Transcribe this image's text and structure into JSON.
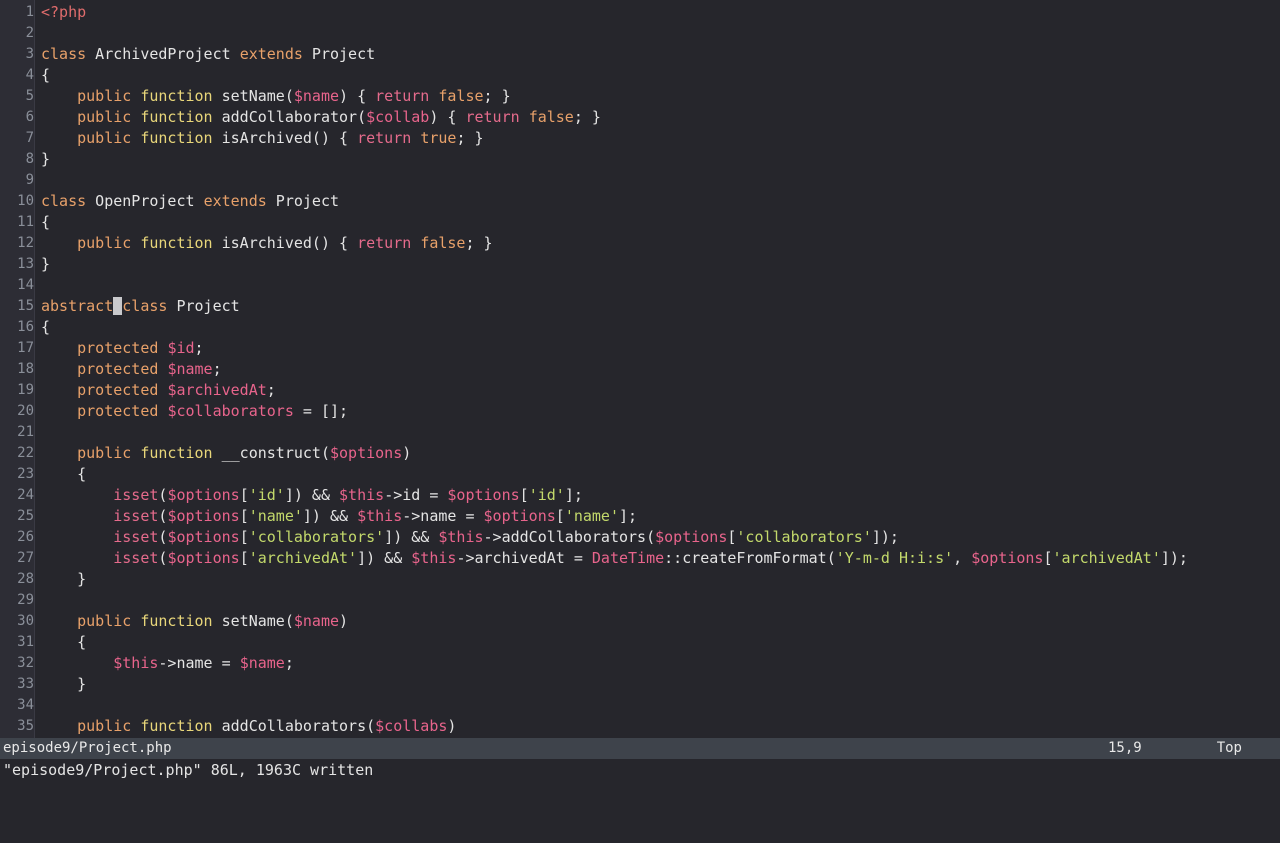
{
  "app": {
    "type": "terminal-text-editor",
    "editor": "vim",
    "language": "php"
  },
  "theme": {
    "background": "#26262c",
    "gutter_background": "#2d2d35",
    "gutter_text": "#8a8f99",
    "default_text": "#d8d8d8",
    "keyword": "#e8a16a",
    "function_keyword": "#e8d67a",
    "control": "#e56b8c",
    "variable": "#e8648c",
    "string": "#c3d96b",
    "tag": "#e06c6c",
    "class_name": "#e8648c",
    "statusline_background": "#3e434b",
    "statusline_text": "#e8e8e8",
    "cursor": "#c9c9cc"
  },
  "cursor": {
    "line": 15,
    "column": 9,
    "token_index": 1
  },
  "statusline": {
    "filename": "episode9/Project.php",
    "position": "15,9",
    "scroll": "Top"
  },
  "cmdline": {
    "message": "\"episode9/Project.php\" 86L, 1963C written"
  },
  "code": {
    "lines": [
      {
        "n": "1",
        "tokens": [
          {
            "t": "<?php",
            "c": "tok-tag"
          }
        ]
      },
      {
        "n": "2",
        "tokens": []
      },
      {
        "n": "3",
        "tokens": [
          {
            "t": "class",
            "c": "tok-kw"
          },
          {
            "t": " ArchivedProject ",
            "c": "tok-plain"
          },
          {
            "t": "extends",
            "c": "tok-kw"
          },
          {
            "t": " Project",
            "c": "tok-plain"
          }
        ]
      },
      {
        "n": "4",
        "tokens": [
          {
            "t": "{",
            "c": "tok-punc"
          }
        ]
      },
      {
        "n": "5",
        "tokens": [
          {
            "t": "    ",
            "c": "tok-plain"
          },
          {
            "t": "public",
            "c": "tok-kw"
          },
          {
            "t": " ",
            "c": "tok-plain"
          },
          {
            "t": "function",
            "c": "tok-fnkw"
          },
          {
            "t": " setName(",
            "c": "tok-plain"
          },
          {
            "t": "$name",
            "c": "tok-var"
          },
          {
            "t": ") { ",
            "c": "tok-plain"
          },
          {
            "t": "return",
            "c": "tok-ctrl"
          },
          {
            "t": " ",
            "c": "tok-plain"
          },
          {
            "t": "false",
            "c": "tok-const"
          },
          {
            "t": "; }",
            "c": "tok-plain"
          }
        ]
      },
      {
        "n": "6",
        "tokens": [
          {
            "t": "    ",
            "c": "tok-plain"
          },
          {
            "t": "public",
            "c": "tok-kw"
          },
          {
            "t": " ",
            "c": "tok-plain"
          },
          {
            "t": "function",
            "c": "tok-fnkw"
          },
          {
            "t": " addCollaborator(",
            "c": "tok-plain"
          },
          {
            "t": "$collab",
            "c": "tok-var"
          },
          {
            "t": ") { ",
            "c": "tok-plain"
          },
          {
            "t": "return",
            "c": "tok-ctrl"
          },
          {
            "t": " ",
            "c": "tok-plain"
          },
          {
            "t": "false",
            "c": "tok-const"
          },
          {
            "t": "; }",
            "c": "tok-plain"
          }
        ]
      },
      {
        "n": "7",
        "tokens": [
          {
            "t": "    ",
            "c": "tok-plain"
          },
          {
            "t": "public",
            "c": "tok-kw"
          },
          {
            "t": " ",
            "c": "tok-plain"
          },
          {
            "t": "function",
            "c": "tok-fnkw"
          },
          {
            "t": " isArchived() { ",
            "c": "tok-plain"
          },
          {
            "t": "return",
            "c": "tok-ctrl"
          },
          {
            "t": " ",
            "c": "tok-plain"
          },
          {
            "t": "true",
            "c": "tok-const"
          },
          {
            "t": "; }",
            "c": "tok-plain"
          }
        ]
      },
      {
        "n": "8",
        "tokens": [
          {
            "t": "}",
            "c": "tok-punc"
          }
        ]
      },
      {
        "n": "9",
        "tokens": []
      },
      {
        "n": "10",
        "tokens": [
          {
            "t": "class",
            "c": "tok-kw"
          },
          {
            "t": " OpenProject ",
            "c": "tok-plain"
          },
          {
            "t": "extends",
            "c": "tok-kw"
          },
          {
            "t": " Project",
            "c": "tok-plain"
          }
        ]
      },
      {
        "n": "11",
        "tokens": [
          {
            "t": "{",
            "c": "tok-punc"
          }
        ]
      },
      {
        "n": "12",
        "tokens": [
          {
            "t": "    ",
            "c": "tok-plain"
          },
          {
            "t": "public",
            "c": "tok-kw"
          },
          {
            "t": " ",
            "c": "tok-plain"
          },
          {
            "t": "function",
            "c": "tok-fnkw"
          },
          {
            "t": " isArchived() { ",
            "c": "tok-plain"
          },
          {
            "t": "return",
            "c": "tok-ctrl"
          },
          {
            "t": " ",
            "c": "tok-plain"
          },
          {
            "t": "false",
            "c": "tok-const"
          },
          {
            "t": "; }",
            "c": "tok-plain"
          }
        ]
      },
      {
        "n": "13",
        "tokens": [
          {
            "t": "}",
            "c": "tok-punc"
          }
        ]
      },
      {
        "n": "14",
        "tokens": []
      },
      {
        "n": "15",
        "tokens": [
          {
            "t": "abstract",
            "c": "tok-kw"
          },
          {
            "t": " ",
            "c": "cursor"
          },
          {
            "t": "class",
            "c": "tok-kw"
          },
          {
            "t": " Project",
            "c": "tok-plain"
          }
        ]
      },
      {
        "n": "16",
        "tokens": [
          {
            "t": "{",
            "c": "tok-punc"
          }
        ]
      },
      {
        "n": "17",
        "tokens": [
          {
            "t": "    ",
            "c": "tok-plain"
          },
          {
            "t": "protected",
            "c": "tok-kw"
          },
          {
            "t": " ",
            "c": "tok-plain"
          },
          {
            "t": "$id",
            "c": "tok-var"
          },
          {
            "t": ";",
            "c": "tok-plain"
          }
        ]
      },
      {
        "n": "18",
        "tokens": [
          {
            "t": "    ",
            "c": "tok-plain"
          },
          {
            "t": "protected",
            "c": "tok-kw"
          },
          {
            "t": " ",
            "c": "tok-plain"
          },
          {
            "t": "$name",
            "c": "tok-var"
          },
          {
            "t": ";",
            "c": "tok-plain"
          }
        ]
      },
      {
        "n": "19",
        "tokens": [
          {
            "t": "    ",
            "c": "tok-plain"
          },
          {
            "t": "protected",
            "c": "tok-kw"
          },
          {
            "t": " ",
            "c": "tok-plain"
          },
          {
            "t": "$archivedAt",
            "c": "tok-var"
          },
          {
            "t": ";",
            "c": "tok-plain"
          }
        ]
      },
      {
        "n": "20",
        "tokens": [
          {
            "t": "    ",
            "c": "tok-plain"
          },
          {
            "t": "protected",
            "c": "tok-kw"
          },
          {
            "t": " ",
            "c": "tok-plain"
          },
          {
            "t": "$collaborators",
            "c": "tok-var"
          },
          {
            "t": " = [];",
            "c": "tok-plain"
          }
        ]
      },
      {
        "n": "21",
        "tokens": []
      },
      {
        "n": "22",
        "tokens": [
          {
            "t": "    ",
            "c": "tok-plain"
          },
          {
            "t": "public",
            "c": "tok-kw"
          },
          {
            "t": " ",
            "c": "tok-plain"
          },
          {
            "t": "function",
            "c": "tok-fnkw"
          },
          {
            "t": " __construct(",
            "c": "tok-plain"
          },
          {
            "t": "$options",
            "c": "tok-var"
          },
          {
            "t": ")",
            "c": "tok-plain"
          }
        ]
      },
      {
        "n": "23",
        "tokens": [
          {
            "t": "    {",
            "c": "tok-punc"
          }
        ]
      },
      {
        "n": "24",
        "tokens": [
          {
            "t": "        ",
            "c": "tok-plain"
          },
          {
            "t": "isset",
            "c": "tok-ctrl"
          },
          {
            "t": "(",
            "c": "tok-plain"
          },
          {
            "t": "$options",
            "c": "tok-var"
          },
          {
            "t": "[",
            "c": "tok-plain"
          },
          {
            "t": "'id'",
            "c": "tok-str"
          },
          {
            "t": "]) && ",
            "c": "tok-plain"
          },
          {
            "t": "$this",
            "c": "tok-var"
          },
          {
            "t": "->id = ",
            "c": "tok-plain"
          },
          {
            "t": "$options",
            "c": "tok-var"
          },
          {
            "t": "[",
            "c": "tok-plain"
          },
          {
            "t": "'id'",
            "c": "tok-str"
          },
          {
            "t": "];",
            "c": "tok-plain"
          }
        ]
      },
      {
        "n": "25",
        "tokens": [
          {
            "t": "        ",
            "c": "tok-plain"
          },
          {
            "t": "isset",
            "c": "tok-ctrl"
          },
          {
            "t": "(",
            "c": "tok-plain"
          },
          {
            "t": "$options",
            "c": "tok-var"
          },
          {
            "t": "[",
            "c": "tok-plain"
          },
          {
            "t": "'name'",
            "c": "tok-str"
          },
          {
            "t": "]) && ",
            "c": "tok-plain"
          },
          {
            "t": "$this",
            "c": "tok-var"
          },
          {
            "t": "->name = ",
            "c": "tok-plain"
          },
          {
            "t": "$options",
            "c": "tok-var"
          },
          {
            "t": "[",
            "c": "tok-plain"
          },
          {
            "t": "'name'",
            "c": "tok-str"
          },
          {
            "t": "];",
            "c": "tok-plain"
          }
        ]
      },
      {
        "n": "26",
        "tokens": [
          {
            "t": "        ",
            "c": "tok-plain"
          },
          {
            "t": "isset",
            "c": "tok-ctrl"
          },
          {
            "t": "(",
            "c": "tok-plain"
          },
          {
            "t": "$options",
            "c": "tok-var"
          },
          {
            "t": "[",
            "c": "tok-plain"
          },
          {
            "t": "'collaborators'",
            "c": "tok-str"
          },
          {
            "t": "]) && ",
            "c": "tok-plain"
          },
          {
            "t": "$this",
            "c": "tok-var"
          },
          {
            "t": "->addCollaborators(",
            "c": "tok-plain"
          },
          {
            "t": "$options",
            "c": "tok-var"
          },
          {
            "t": "[",
            "c": "tok-plain"
          },
          {
            "t": "'collaborators'",
            "c": "tok-str"
          },
          {
            "t": "]);",
            "c": "tok-plain"
          }
        ]
      },
      {
        "n": "27",
        "tokens": [
          {
            "t": "        ",
            "c": "tok-plain"
          },
          {
            "t": "isset",
            "c": "tok-ctrl"
          },
          {
            "t": "(",
            "c": "tok-plain"
          },
          {
            "t": "$options",
            "c": "tok-var"
          },
          {
            "t": "[",
            "c": "tok-plain"
          },
          {
            "t": "'archivedAt'",
            "c": "tok-str"
          },
          {
            "t": "]) && ",
            "c": "tok-plain"
          },
          {
            "t": "$this",
            "c": "tok-var"
          },
          {
            "t": "->archivedAt = ",
            "c": "tok-plain"
          },
          {
            "t": "DateTime",
            "c": "tok-cls"
          },
          {
            "t": "::createFromFormat(",
            "c": "tok-plain"
          },
          {
            "t": "'Y-m-d H:i:s'",
            "c": "tok-str"
          },
          {
            "t": ", ",
            "c": "tok-plain"
          },
          {
            "t": "$options",
            "c": "tok-var"
          },
          {
            "t": "[",
            "c": "tok-plain"
          },
          {
            "t": "'archivedAt'",
            "c": "tok-str"
          },
          {
            "t": "]);",
            "c": "tok-plain"
          }
        ]
      },
      {
        "n": "28",
        "tokens": [
          {
            "t": "    }",
            "c": "tok-punc"
          }
        ]
      },
      {
        "n": "29",
        "tokens": []
      },
      {
        "n": "30",
        "tokens": [
          {
            "t": "    ",
            "c": "tok-plain"
          },
          {
            "t": "public",
            "c": "tok-kw"
          },
          {
            "t": " ",
            "c": "tok-plain"
          },
          {
            "t": "function",
            "c": "tok-fnkw"
          },
          {
            "t": " setName(",
            "c": "tok-plain"
          },
          {
            "t": "$name",
            "c": "tok-var"
          },
          {
            "t": ")",
            "c": "tok-plain"
          }
        ]
      },
      {
        "n": "31",
        "tokens": [
          {
            "t": "    {",
            "c": "tok-punc"
          }
        ]
      },
      {
        "n": "32",
        "tokens": [
          {
            "t": "        ",
            "c": "tok-plain"
          },
          {
            "t": "$this",
            "c": "tok-var"
          },
          {
            "t": "->name = ",
            "c": "tok-plain"
          },
          {
            "t": "$name",
            "c": "tok-var"
          },
          {
            "t": ";",
            "c": "tok-plain"
          }
        ]
      },
      {
        "n": "33",
        "tokens": [
          {
            "t": "    }",
            "c": "tok-punc"
          }
        ]
      },
      {
        "n": "34",
        "tokens": []
      },
      {
        "n": "35",
        "tokens": [
          {
            "t": "    ",
            "c": "tok-plain"
          },
          {
            "t": "public",
            "c": "tok-kw"
          },
          {
            "t": " ",
            "c": "tok-plain"
          },
          {
            "t": "function",
            "c": "tok-fnkw"
          },
          {
            "t": " addCollaborators(",
            "c": "tok-plain"
          },
          {
            "t": "$collabs",
            "c": "tok-var"
          },
          {
            "t": ")",
            "c": "tok-plain"
          }
        ]
      }
    ]
  }
}
